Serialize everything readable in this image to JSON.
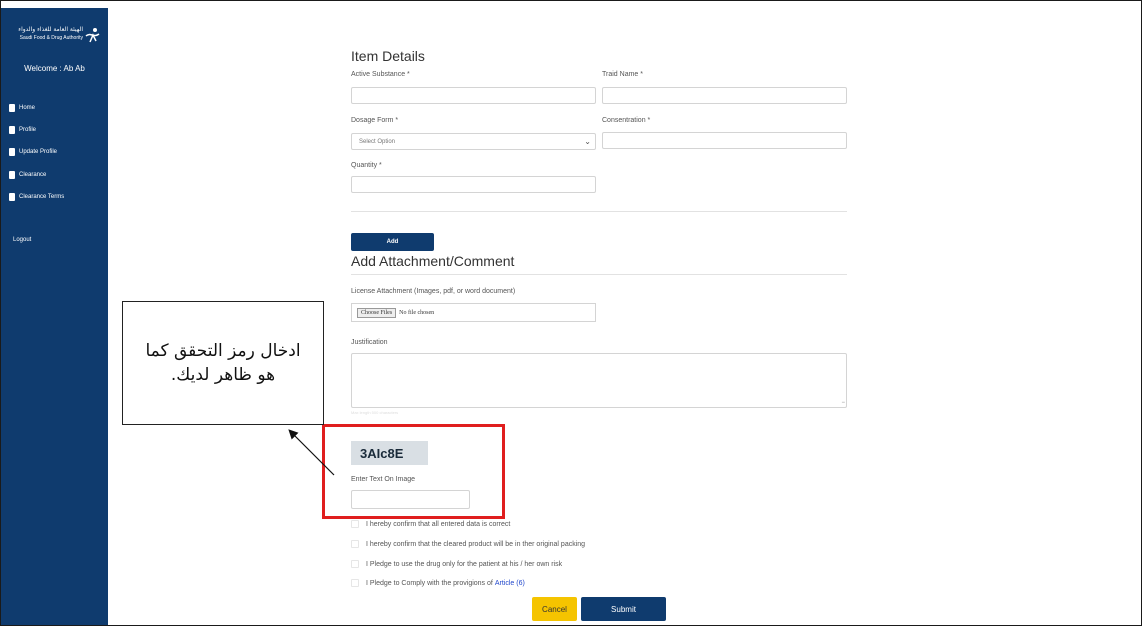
{
  "sidebar": {
    "logo_ar": "الهيئة العامة للغذاء والدواء",
    "logo_en": "Saudi Food & Drug Authority",
    "welcome": "Welcome : Ab Ab",
    "items": [
      {
        "label": "Home"
      },
      {
        "label": "Profile"
      },
      {
        "label": "Update Profile"
      },
      {
        "label": "Clearance"
      },
      {
        "label": "Clearance Terms"
      }
    ],
    "logout": "Logout"
  },
  "item_details": {
    "title": "Item Details",
    "active_substance_label": "Active Substance *",
    "trade_name_label": "Traid Name *",
    "dosage_form_label": "Dosage Form *",
    "dosage_form_value": "Select Option",
    "concentration_label": "Consentration *",
    "quantity_label": "Quantity *",
    "add_button": "Add"
  },
  "attachment": {
    "title": "Add Attachment/Comment",
    "license_label": "License Attachment (Images, pdf, or word document)",
    "choose_files": "Choose Files",
    "no_file": "No file chosen",
    "justification_label": "Justification",
    "faint_note": "Max length 500 characters"
  },
  "captcha": {
    "code": "3AIc8E",
    "label": "Enter Text On Image"
  },
  "confirmations": [
    {
      "text": "I hereby confirm that all entered data is correct"
    },
    {
      "text": "I hereby confirm that the cleared product will be in ther original packing"
    },
    {
      "text": "I Pledge to use the drug only for the patient at his / her own risk"
    },
    {
      "text": "I Pledge to Comply with the provigions of",
      "link": "Article (6)"
    }
  ],
  "buttons": {
    "cancel": "Cancel",
    "submit": "Submit"
  },
  "callout": {
    "text": "ادخال رمز التحقق كما هو ظاهر لديك."
  },
  "colors": {
    "sidebar": "#0f3b6e",
    "cancel": "#f5c400",
    "highlight": "#e01e1e",
    "link": "#2248cc"
  }
}
